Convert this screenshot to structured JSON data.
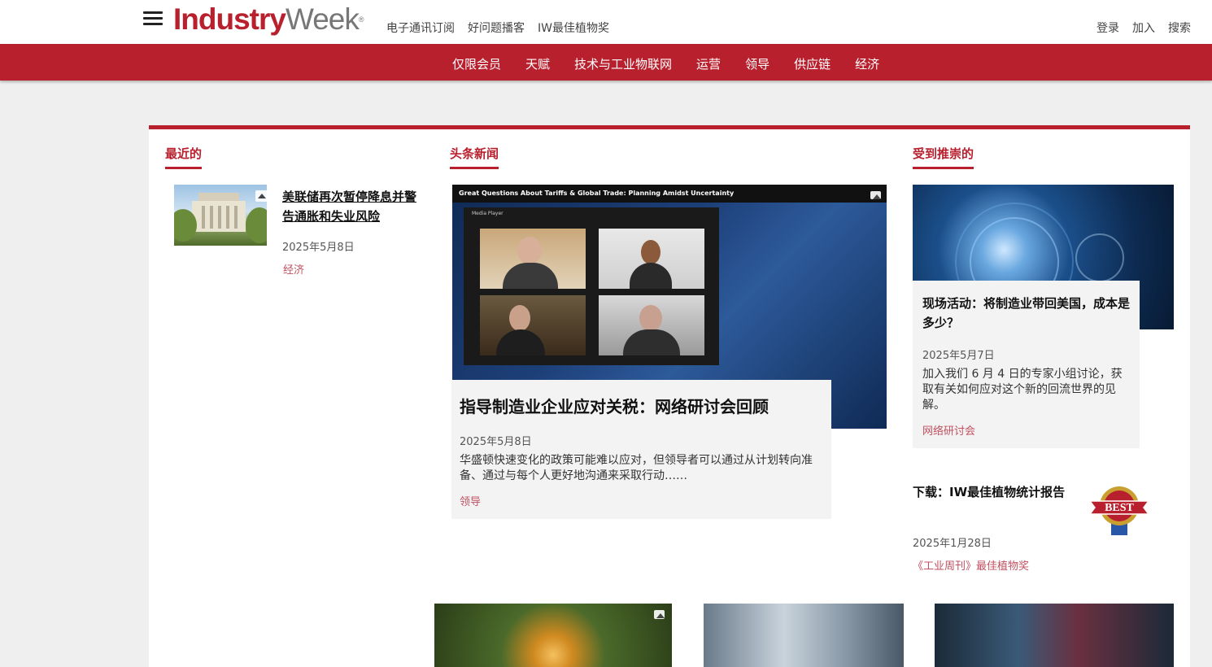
{
  "header": {
    "logo_industry": "Industry",
    "logo_week": "Week",
    "logo_reg": "®",
    "top_links": [
      "电子通讯订阅",
      "好问题播客",
      "IW最佳植物奖"
    ],
    "right_links": [
      "登录",
      "加入",
      "搜索"
    ]
  },
  "nav": {
    "items": [
      "仅限会员",
      "天赋",
      "技术与工业物联网",
      "运营",
      "领导",
      "供应链",
      "经济"
    ]
  },
  "sections": {
    "recent": "最近的",
    "headline": "头条新闻",
    "featured": "受到推崇的"
  },
  "recent_article": {
    "title": "美联储再次暂停降息并警告通胀和失业风险",
    "date": "2025年5月8日",
    "category": "经济"
  },
  "headline_article": {
    "video_title": "Great Questions About Tariffs & Global Trade: Planning Amidst Uncertainty",
    "player_label": "Media Player",
    "title": "指导制造业企业应对关税：网络研讨会回顾",
    "date": "2025年5月8日",
    "summary": "华盛顿快速变化的政策可能难以应对，但领导者可以通过从计划转向准备、通过与每个人更好地沟通来采取行动……",
    "category": "领导"
  },
  "featured_article": {
    "title": "现场活动：将制造业带回美国，成本是多少？",
    "date": "2025年5月7日",
    "summary": "加入我们 6 月 4 日的专家小组讨论，获取有关如何应对这个新的回流世界的见解。",
    "category": "网络研讨会"
  },
  "download_article": {
    "title": "下载：IW最佳植物统计报告",
    "date": "2025年1月28日",
    "category": "《工业周刊》最佳植物奖",
    "badge_text": "BEST"
  },
  "colors": {
    "brand_red": "#b8202e",
    "category_text": "#c05060"
  }
}
